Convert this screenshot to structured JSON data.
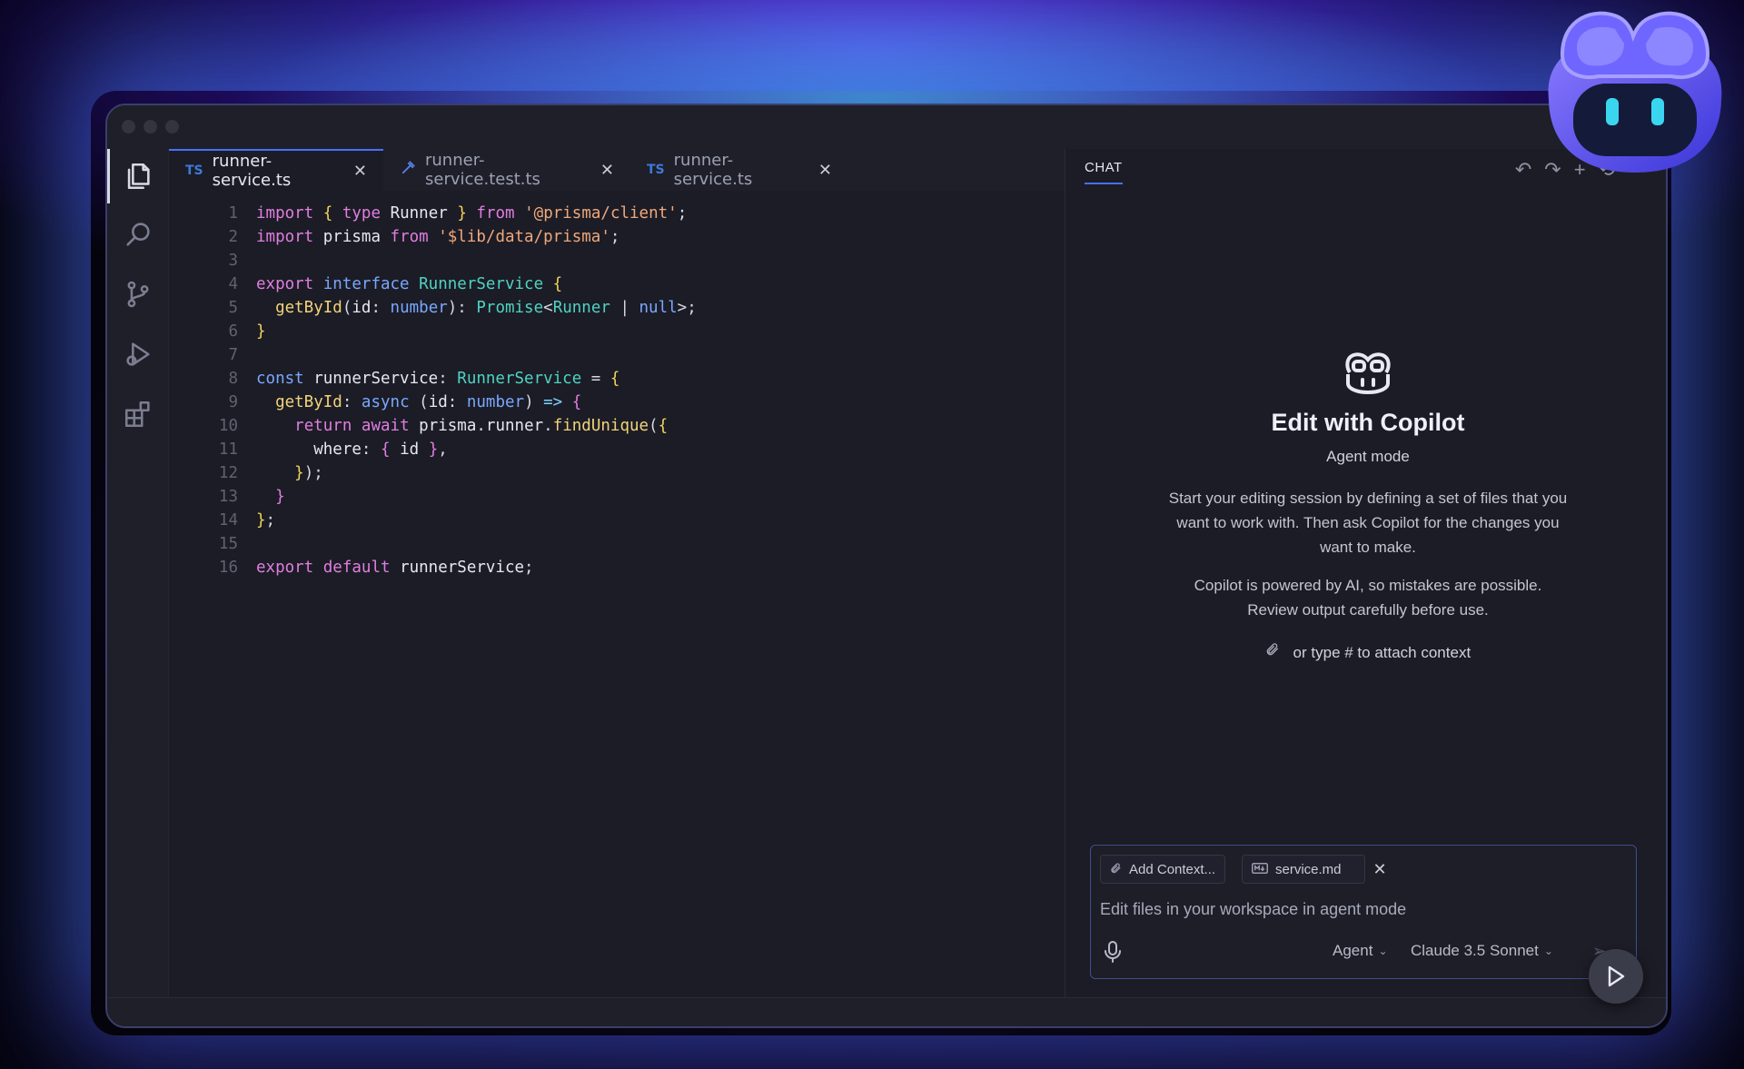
{
  "colors": {
    "accent": "#4c6fff",
    "background": "#1b1c25",
    "glow_purple": "#6e28ff",
    "glow_teal": "#28dcc8"
  },
  "editor": {
    "tabs": [
      {
        "icon": "TS",
        "label": "runner-service.ts",
        "active": true
      },
      {
        "icon": "test-file-icon",
        "label": "runner-service.test.ts",
        "active": false
      },
      {
        "icon": "TS",
        "label": "runner-service.ts",
        "active": false
      }
    ],
    "close_glyph": "✕",
    "line_numbers": [
      "1",
      "2",
      "3",
      "4",
      "5",
      "6",
      "7",
      "8",
      "9",
      "10",
      "11",
      "12",
      "13",
      "14",
      "15",
      "16"
    ],
    "code_lines": [
      "import { type Runner } from '@prisma/client';",
      "import prisma from '$lib/data/prisma';",
      "",
      "export interface RunnerService {",
      "  getById(id: number): Promise<Runner | null>;",
      "}",
      "",
      "const runnerService: RunnerService = {",
      "  getById: async (id: number) => {",
      "    return await prisma.runner.findUnique({",
      "      where: { id },",
      "    });",
      "  }",
      "};",
      "",
      "export default runnerService;"
    ]
  },
  "chat": {
    "tab_label": "CHAT",
    "title": "Edit with Copilot",
    "mode": "Agent mode",
    "description_1": "Start your editing session by defining a set of files that you want to work with. Then ask Copilot for the changes you want to make.",
    "description_2": "Copilot is powered by AI, so mistakes are possible. Review output carefully before use.",
    "attach_hint": "or type # to attach context",
    "input": {
      "add_context_label": "Add Context...",
      "file_chip_label": "service.md",
      "placeholder": "Edit files in your workspace in agent mode",
      "mode_select": "Agent",
      "model_select": "Claude 3.5 Sonnet"
    }
  }
}
